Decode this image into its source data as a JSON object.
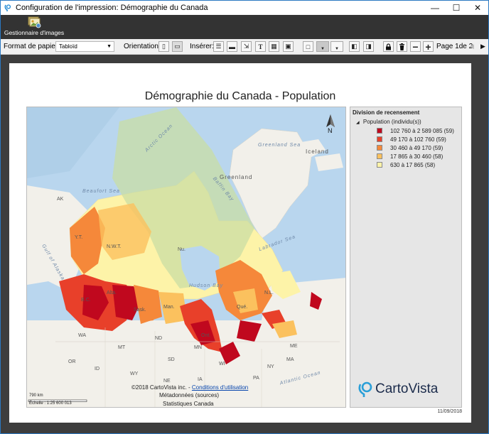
{
  "window": {
    "title": "Configuration de l'impression:  Démographie du Canada",
    "icon": "cartovista-icon",
    "controls": [
      "—",
      "☐",
      "✕"
    ]
  },
  "ribbon": {
    "image_manager_label": "Gestionnaire d'images"
  },
  "toolbar": {
    "paper_format_label": "Format de papier",
    "paper_format_value": "Tabloïd",
    "orientation_label": "Orientation",
    "insert_label": "Insérer:",
    "page_label": "Page",
    "page_current": "1",
    "page_of": "de",
    "page_total": "2"
  },
  "document": {
    "title": "Démographie du Canada - Population",
    "date": "11/09/2018"
  },
  "map": {
    "copyright": "©2018 CartoVista inc. - ",
    "terms_link": "Conditions d'utilisation",
    "metadata": "Métadonnées (sources)",
    "source": "Statistiques Canada",
    "scale_distance": "790 km",
    "scale_label": "Échelle : 1:25 600 013",
    "north_letter": "N",
    "labels": {
      "arctic_ocean": "Arctic Ocean",
      "baffin_bay": "Baffin Bay",
      "greenland_sea": "Greenland Sea",
      "iceland": "Iceland",
      "greenland": "Greenland",
      "ak": "AK",
      "beaufort_sea": "Beaufort Sea",
      "labrador_sea": "Labrador Sea",
      "gulf_of_alaska": "Gulf of Alaska",
      "yt": "Y.T.",
      "nwt": "N.W.T.",
      "nu": "Nu.",
      "hudson_bay": "Hudson Bay",
      "nl": "N.L.",
      "alta": "Alta.",
      "bc": "B.C.",
      "sask": "Sask.",
      "man": "Man.",
      "que": "Qué.",
      "ont": "Ont.",
      "wa": "WA",
      "mt": "MT",
      "nd": "ND",
      "mn": "MN",
      "or": "OR",
      "id": "ID",
      "wy": "WY",
      "sd": "SD",
      "ia": "IA",
      "wi": "WI",
      "ne": "NE",
      "me": "ME",
      "ny": "NY",
      "pa": "PA",
      "ma": "MA",
      "atlantic_ocean": "Atlantic Ocean"
    }
  },
  "legend": {
    "title": "Division de recensement",
    "layer": "Population (individu(s))",
    "items": [
      {
        "label": "102 760 à 2 589 085 (59)",
        "color": "#c0081e"
      },
      {
        "label": "49 170 à 102 760 (59)",
        "color": "#e8402a"
      },
      {
        "label": "30 460 à 49 170 (59)",
        "color": "#f5883a"
      },
      {
        "label": "17 865 à 30 460 (58)",
        "color": "#fbc15e"
      },
      {
        "label": "630 à 17 865 (58)",
        "color": "#fdf3a8"
      }
    ],
    "logo_text": "CartoVista"
  },
  "colors": {
    "accent": "#2b79c2",
    "ribbon_bg": "#333333",
    "page_bg": "#3d3d3d",
    "water": "#b9d6ee",
    "land": "#f2f0ea",
    "nunavut": "#c9dea4"
  }
}
